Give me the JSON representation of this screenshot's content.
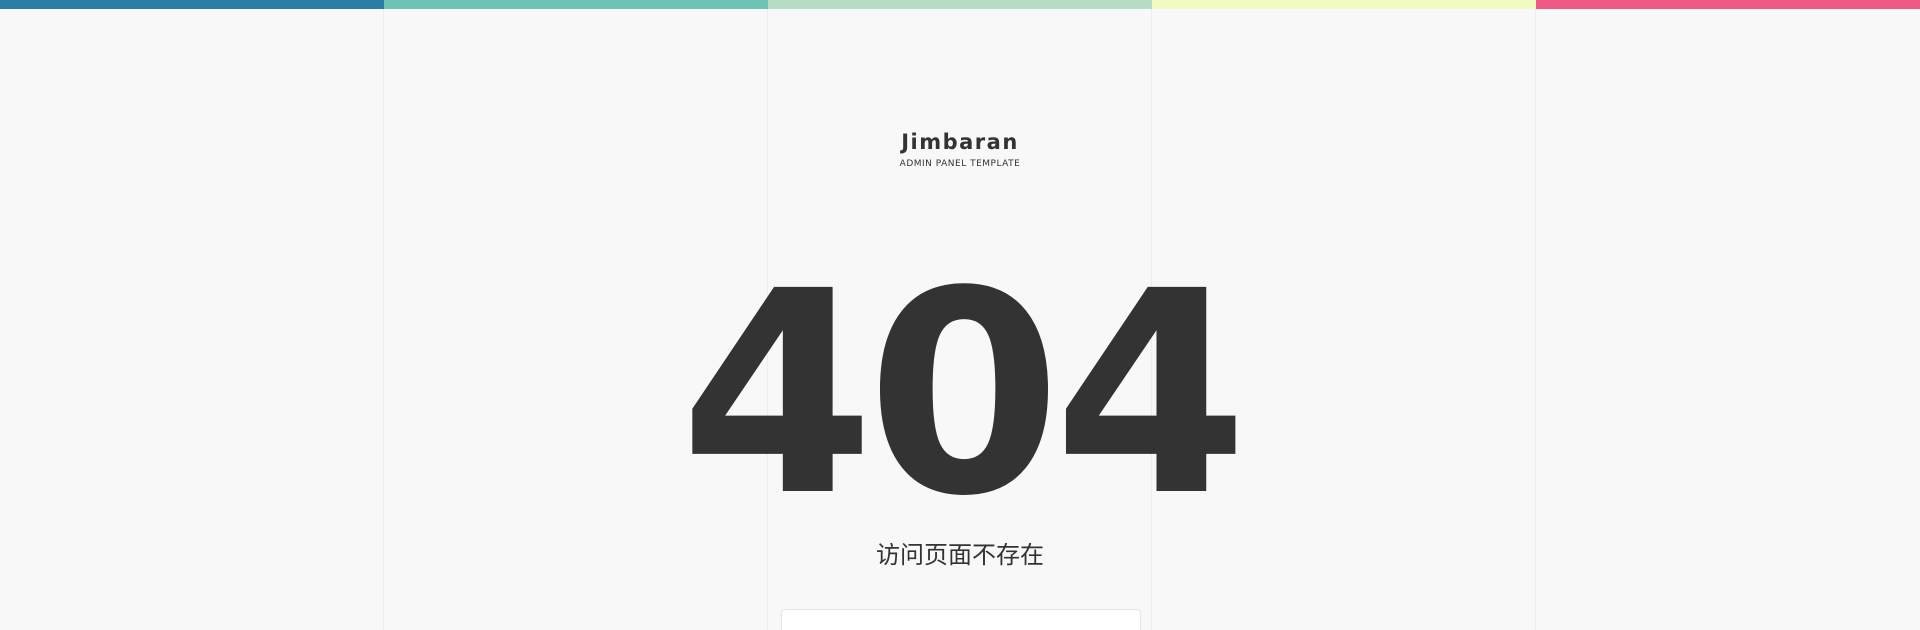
{
  "color_bar": {
    "segments": [
      "#2a7da6",
      "#6fc3b5",
      "#b7dec5",
      "#f3f9c2",
      "#f05987"
    ]
  },
  "brand": {
    "name": "Jimbaran",
    "tagline": "ADMIN PANEL TEMPLATE"
  },
  "error": {
    "code": "404",
    "message": "访问页面不存在"
  }
}
